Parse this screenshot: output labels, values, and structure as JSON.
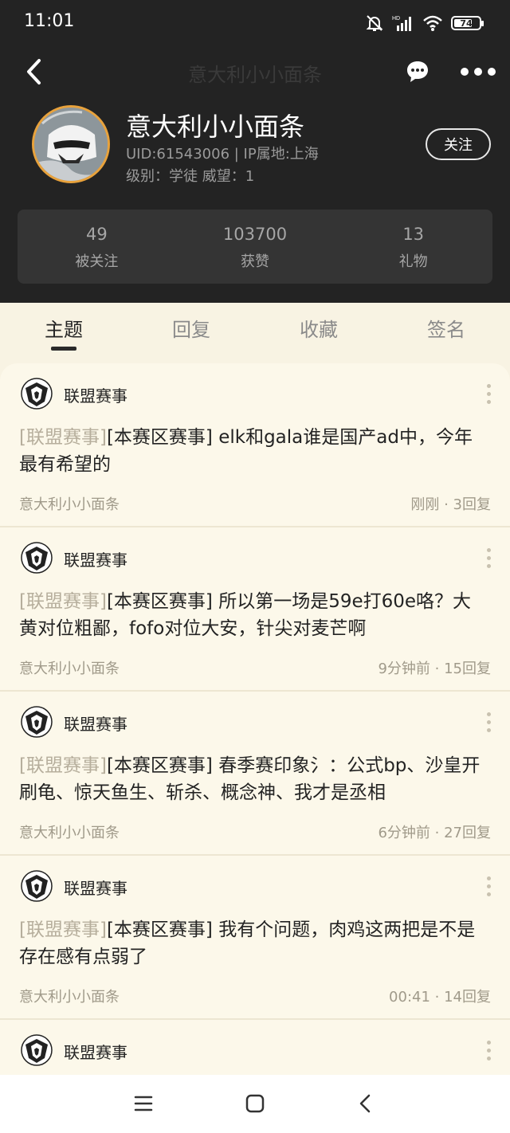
{
  "status_bar": {
    "time": "11:01",
    "battery": 74,
    "battery_text": "74",
    "icons": [
      "mute-bell-icon",
      "hd-signal-icon",
      "wifi-icon",
      "battery-icon"
    ]
  },
  "nav": {
    "title": "意大利小小面条",
    "back_icon": "chevron-left-icon",
    "chat_icon": "chat-bubble-icon",
    "more_icon": "ellipsis-icon"
  },
  "profile": {
    "name": "意大利小小面条",
    "uid_line": "UID:61543006 | IP属地:上海",
    "level_line": "级别：学徒   威望：1",
    "follow_label": "关注"
  },
  "stats": [
    {
      "value": "49",
      "label": "被关注"
    },
    {
      "value": "103700",
      "label": "获赞"
    },
    {
      "value": "13",
      "label": "礼物"
    }
  ],
  "tabs": [
    {
      "label": "主题",
      "active": true
    },
    {
      "label": "回复",
      "active": false
    },
    {
      "label": "收藏",
      "active": false
    },
    {
      "label": "签名",
      "active": false
    }
  ],
  "posts": [
    {
      "forum": "联盟赛事",
      "prefix": "[联盟赛事]",
      "title": "[本赛区赛事] elk和gala谁是国产ad中，今年最有希望的",
      "author": "意大利小小面条",
      "meta": "刚刚 · 3回复"
    },
    {
      "forum": "联盟赛事",
      "prefix": "[联盟赛事]",
      "title": "[本赛区赛事] 所以第一场是59e打60e咯？大黄对位粗鄙，fofo对位大安，针尖对麦芒啊",
      "author": "意大利小小面条",
      "meta": "9分钟前 · 15回复"
    },
    {
      "forum": "联盟赛事",
      "prefix": "[联盟赛事]",
      "title": "[本赛区赛事] 春季赛印象氵：公式bp、沙皇开刷龟、惊天鱼生、斩杀、概念神、我才是丞相",
      "author": "意大利小小面条",
      "meta": "6分钟前 · 27回复"
    },
    {
      "forum": "联盟赛事",
      "prefix": "[联盟赛事]",
      "title": "[本赛区赛事] 我有个问题，肉鸡这两把是不是存在感有点弱了",
      "author": "意大利小小面条",
      "meta": "00:41 · 14回复"
    },
    {
      "forum": "联盟赛事",
      "prefix": "",
      "title": "",
      "author": "",
      "meta": ""
    }
  ],
  "bottom_nav": {
    "icons": [
      "menu-icon",
      "home-square-icon",
      "back-triangle-icon"
    ]
  },
  "colors": {
    "header_bg": "#232323",
    "feed_bg": "#fcf8ea",
    "accent_ring": "#e8a23c"
  }
}
